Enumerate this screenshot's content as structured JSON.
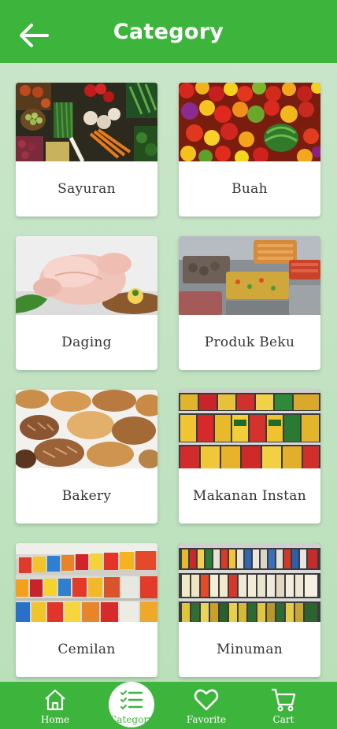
{
  "header": {
    "title": "Category",
    "back_icon": "arrow-left-icon"
  },
  "categories": [
    {
      "label": "Sayuran",
      "image": "vegetables-photo"
    },
    {
      "label": "Buah",
      "image": "fruits-photo"
    },
    {
      "label": "Daging",
      "image": "raw-chicken-photo"
    },
    {
      "label": "Produk Beku",
      "image": "frozen-food-photo"
    },
    {
      "label": "Bakery",
      "image": "bread-photo"
    },
    {
      "label": "Makanan Instan",
      "image": "instant-noodles-shelf-photo"
    },
    {
      "label": "Cemilan",
      "image": "snack-aisle-photo"
    },
    {
      "label": "Minuman",
      "image": "drinks-shelf-photo"
    }
  ],
  "bottom_nav": {
    "items": [
      {
        "label": "Home",
        "icon": "home-icon"
      },
      {
        "label": "Category",
        "icon": "list-check-icon"
      },
      {
        "label": "Favorite",
        "icon": "heart-icon"
      },
      {
        "label": "Cart",
        "icon": "cart-icon"
      }
    ],
    "active_index": 1
  },
  "colors": {
    "primary": "#3db53d",
    "background": "#c4e4c4",
    "card": "#ffffff",
    "label_text": "#333333"
  }
}
